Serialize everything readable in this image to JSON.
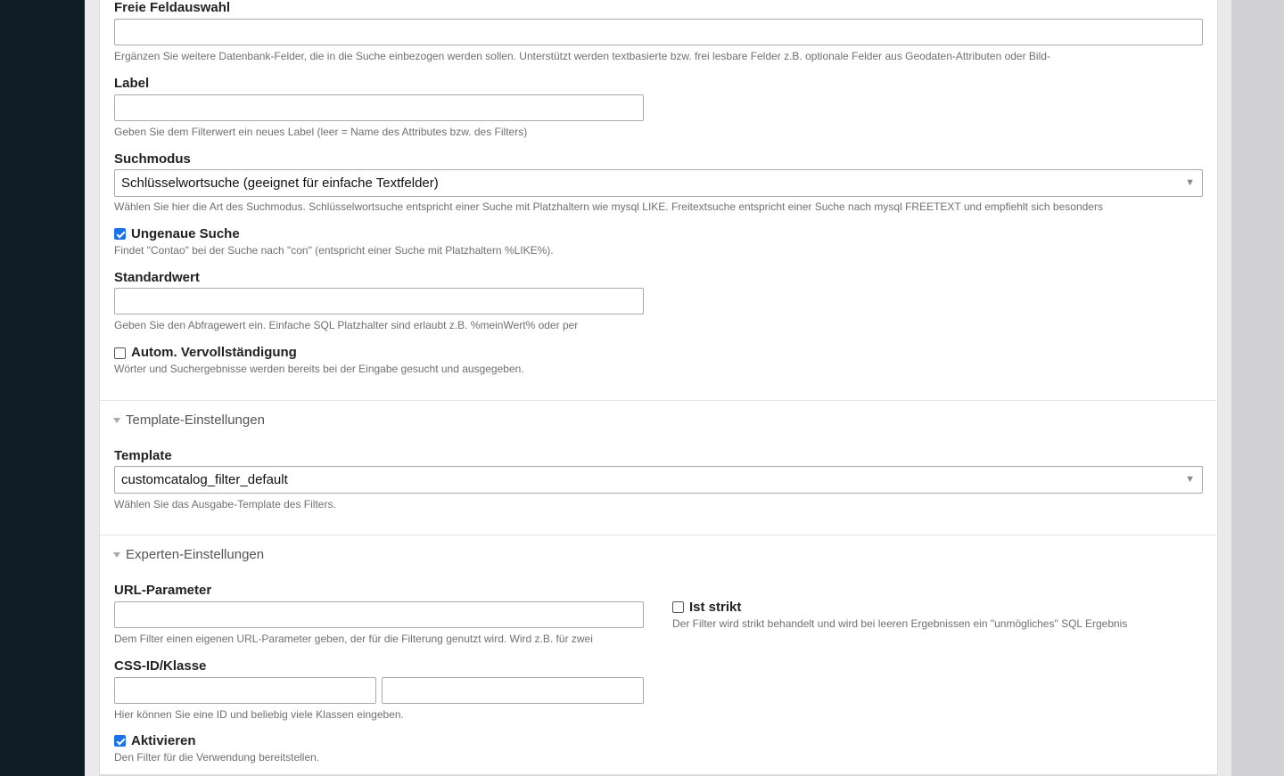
{
  "fields": {
    "freie_feldauswahl": {
      "label": "Freie Feldauswahl",
      "value": "",
      "help": "Ergänzen Sie weitere Datenbank-Felder, die in die Suche einbezogen werden sollen. Unterstützt werden textbasierte bzw. frei lesbare Felder z.B. optionale Felder aus Geodaten-Attributen oder Bild-"
    },
    "label": {
      "label": "Label",
      "value": "",
      "help": "Geben Sie dem Filterwert ein neues Label (leer = Name des Attributes bzw. des Filters)"
    },
    "suchmodus": {
      "label": "Suchmodus",
      "selected": "Schlüsselwortsuche (geeignet für einfache Textfelder)",
      "help": "Wählen Sie hier die Art des Suchmodus. Schlüsselwortsuche entspricht einer Suche mit Platzhaltern wie mysql LIKE. Freitextsuche entspricht einer Suche nach mysql FREETEXT und empfiehlt sich besonders"
    },
    "ungenaue_suche": {
      "label": "Ungenaue Suche",
      "checked": true,
      "help": "Findet \"Contao\" bei der Suche nach \"con\" (entspricht einer Suche mit Platzhaltern %LIKE%)."
    },
    "standardwert": {
      "label": "Standardwert",
      "value": "",
      "help": "Geben Sie den Abfragewert ein. Einfache SQL Platzhalter sind erlaubt z.B. %meinWert% oder per"
    },
    "autocomplete": {
      "label": "Autom. Vervollständigung",
      "checked": false,
      "help": "Wörter und Suchergebnisse werden bereits bei der Eingabe gesucht und ausgegeben."
    }
  },
  "sections": {
    "template": {
      "legend": "Template-Einstellungen",
      "template_label": "Template",
      "template_selected": "customcatalog_filter_default",
      "template_help": "Wählen Sie das Ausgabe-Template des Filters."
    },
    "expert": {
      "legend": "Experten-Einstellungen",
      "url_label": "URL-Parameter",
      "url_value": "",
      "url_help": "Dem Filter einen eigenen URL-Parameter geben, der für die Filterung genutzt wird. Wird z.B. für zwei",
      "strict_label": "Ist strikt",
      "strict_checked": false,
      "strict_help": "Der Filter wird strikt behandelt und wird bei leeren Ergebnissen ein \"unmögliches\" SQL Ergebnis",
      "css_label": "CSS-ID/Klasse",
      "css_id_value": "",
      "css_class_value": "",
      "css_help": "Hier können Sie eine ID und beliebig viele Klassen eingeben.",
      "activate_label": "Aktivieren",
      "activate_checked": true,
      "activate_help": "Den Filter für die Verwendung bereitstellen."
    }
  },
  "icons": {
    "select_arrow": "▼",
    "legend_toggle": "triangle-down"
  },
  "colors": {
    "sidebar": "#0f1c26",
    "checkbox_accent": "#1a73e8"
  }
}
